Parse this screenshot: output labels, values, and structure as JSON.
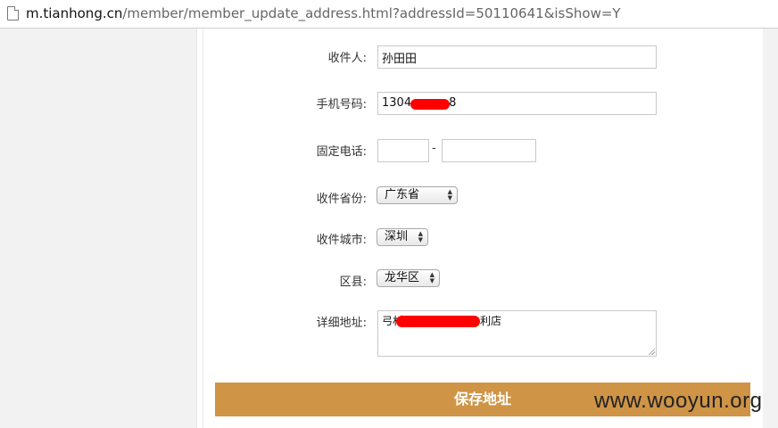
{
  "browser": {
    "url_host": "m.tianhong.cn",
    "url_path": "/member/member_update_address.html?addressId=50110641&isShow=Y"
  },
  "form": {
    "recipient": {
      "label": "收件人:",
      "value": "孙田田"
    },
    "mobile": {
      "label": "手机号码:",
      "value": "1304",
      "value_suffix": "8"
    },
    "landline": {
      "label": "固定电话:",
      "separator": "-",
      "area_code": "",
      "number": ""
    },
    "province": {
      "label": "收件省份:",
      "selected": "广东省"
    },
    "city": {
      "label": "收件城市:",
      "selected": "深圳"
    },
    "district": {
      "label": "区县:",
      "selected": "龙华区"
    },
    "address": {
      "label": "详细地址:",
      "value_prefix": "弓村",
      "value_suffix": "利店"
    },
    "save_label": "保存地址"
  },
  "watermark": "www.wooyun.org"
}
